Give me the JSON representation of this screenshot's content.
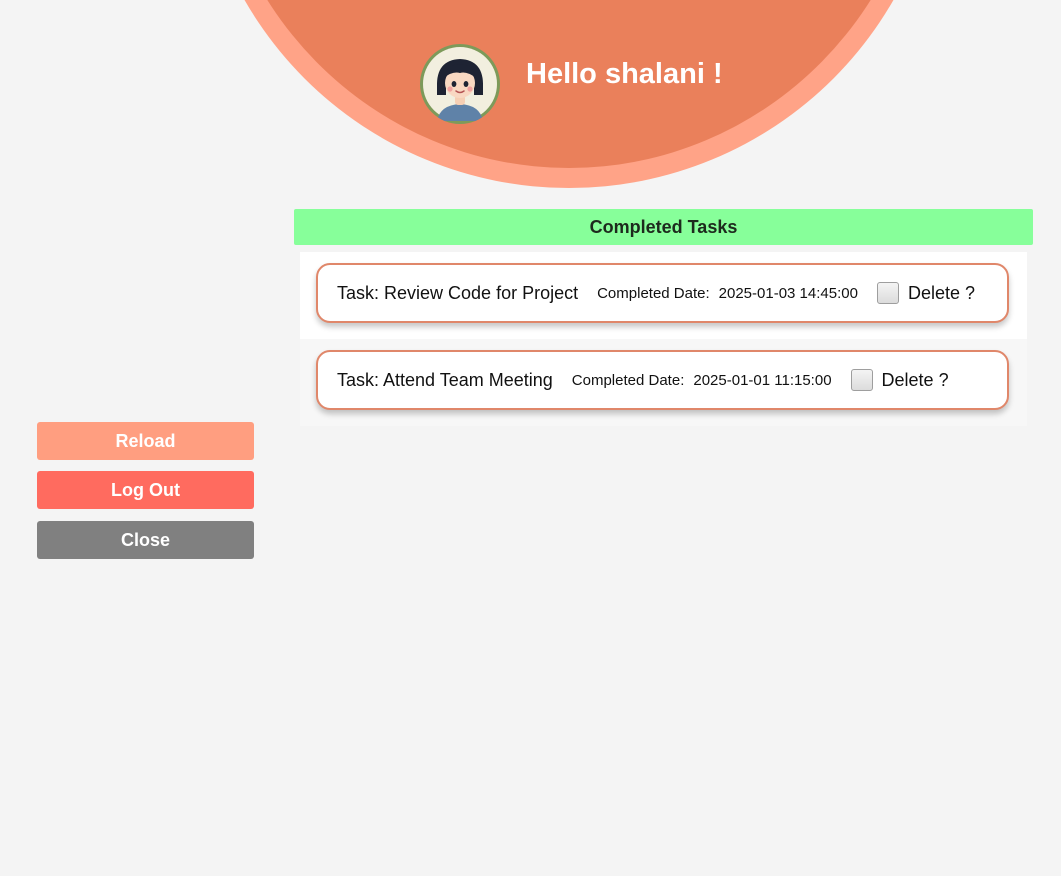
{
  "header": {
    "greeting": "Hello shalani !"
  },
  "colors": {
    "accent": "#ea805b",
    "accent_light": "#ffa387",
    "section_header": "#87ff9a",
    "reload": "#ff9e80",
    "logout": "#ff6b5f",
    "close": "#808080"
  },
  "sidebar": {
    "reload_label": "Reload",
    "logout_label": "Log Out",
    "close_label": "Close"
  },
  "completed": {
    "title": "Completed Tasks",
    "tasks": [
      {
        "name": "Task: Review Code for Project",
        "date_label": "Completed Date:",
        "date": "2025-01-03 14:45:00",
        "delete_label": "Delete ?"
      },
      {
        "name": "Task: Attend Team Meeting",
        "date_label": "Completed Date:",
        "date": "2025-01-01 11:15:00",
        "delete_label": "Delete ?"
      }
    ]
  },
  "icons": {
    "avatar": "girl-avatar-icon"
  }
}
